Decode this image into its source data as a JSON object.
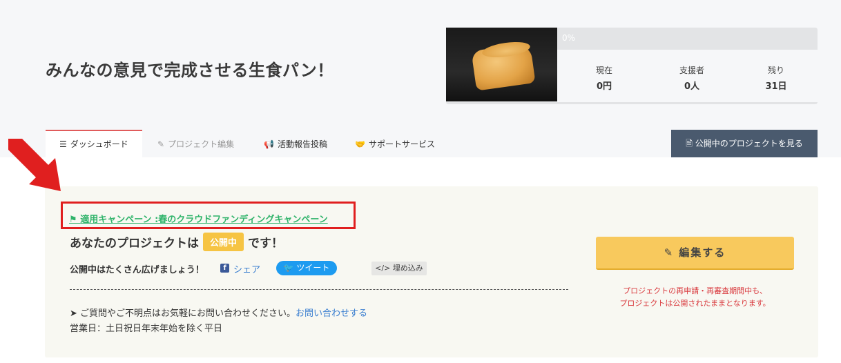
{
  "project": {
    "title": "みんなの意見で完成させる生食パン！"
  },
  "stats": {
    "progress_text": "0%",
    "progress_fraction": 0,
    "current_label": "現在",
    "current_value": "0円",
    "backers_label": "支援者",
    "backers_value": "0人",
    "remaining_label": "残り",
    "remaining_value": "31日"
  },
  "tabs": [
    {
      "label": "ダッシュボード",
      "icon": "list-icon",
      "active": true
    },
    {
      "label": "プロジェクト編集",
      "icon": "pencil-icon",
      "disabled": true
    },
    {
      "label": "活動報告投稿",
      "icon": "megaphone-icon"
    },
    {
      "label": "サポートサービス",
      "icon": "handshake-icon"
    }
  ],
  "view_button": {
    "label": "公開中のプロジェクトを見る",
    "icon": "document-icon"
  },
  "campaign": {
    "label": "適用キャンペーン :春のクラウドファンディングキャンペーン",
    "icon": "flag-icon"
  },
  "status": {
    "prefix": "あなたのプロジェクトは",
    "badge": "公開中",
    "suffix": "です！"
  },
  "share": {
    "label": "公開中はたくさん広げましょう！",
    "facebook": "シェア",
    "tweet": "ツイート",
    "embed": "埋め込み"
  },
  "contact": {
    "text": "ご質問やご不明点はお気軽にお問い合わせください。",
    "link": "お問い合わせする",
    "hours": "営業日：土日祝日年末年始を除く平日"
  },
  "edit": {
    "label": "編集する",
    "notice_line1": "プロジェクトの再申請・再審査期間中も、",
    "notice_line2": "プロジェクトは公開されたままとなります。"
  },
  "colors": {
    "accent_red": "#e01f1f",
    "campaign_green": "#2fb36a",
    "badge_yellow": "#f6c443",
    "edit_yellow": "#f8c95d",
    "nav_dark": "#4a5a6e"
  }
}
